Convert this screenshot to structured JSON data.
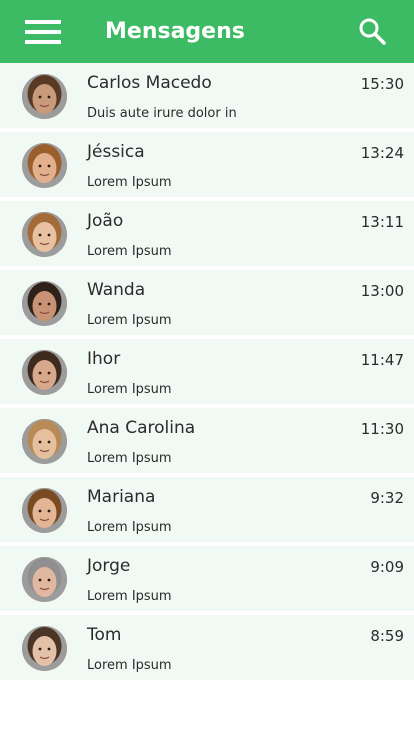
{
  "header": {
    "title": "Mensagens",
    "menu_icon": "hamburger-menu-icon",
    "search_icon": "search-icon",
    "color": "#3dbb64"
  },
  "conversations": [
    {
      "name": "Carlos Macedo",
      "time": "15:30",
      "preview": "Duis aute irure dolor in",
      "skin": "#c99a7b",
      "hair": "#5a3a24"
    },
    {
      "name": "Jéssica",
      "time": "13:24",
      "preview": "Lorem Ipsum",
      "skin": "#e2b08c",
      "hair": "#9a5f2c"
    },
    {
      "name": "João",
      "time": "13:11",
      "preview": "Lorem Ipsum",
      "skin": "#e8c1a2",
      "hair": "#a36b3a"
    },
    {
      "name": "Wanda",
      "time": "13:00",
      "preview": "Lorem Ipsum",
      "skin": "#c89274",
      "hair": "#2e211a"
    },
    {
      "name": "Ihor",
      "time": "11:47",
      "preview": "Lorem Ipsum",
      "skin": "#d7a88b",
      "hair": "#3d2b1f"
    },
    {
      "name": "Ana Carolina",
      "time": "11:30",
      "preview": "Lorem Ipsum",
      "skin": "#e6bf9e",
      "hair": "#b88a54"
    },
    {
      "name": "Mariana",
      "time": "9:32",
      "preview": "Lorem Ipsum",
      "skin": "#e2b594",
      "hair": "#7a4a22"
    },
    {
      "name": "Jorge",
      "time": "9:09",
      "preview": "Lorem Ipsum",
      "skin": "#e0b7a0",
      "hair": "#8f8f8f"
    },
    {
      "name": "Tom",
      "time": "8:59",
      "preview": "Lorem Ipsum",
      "skin": "#e3c0a8",
      "hair": "#4a3526"
    }
  ]
}
